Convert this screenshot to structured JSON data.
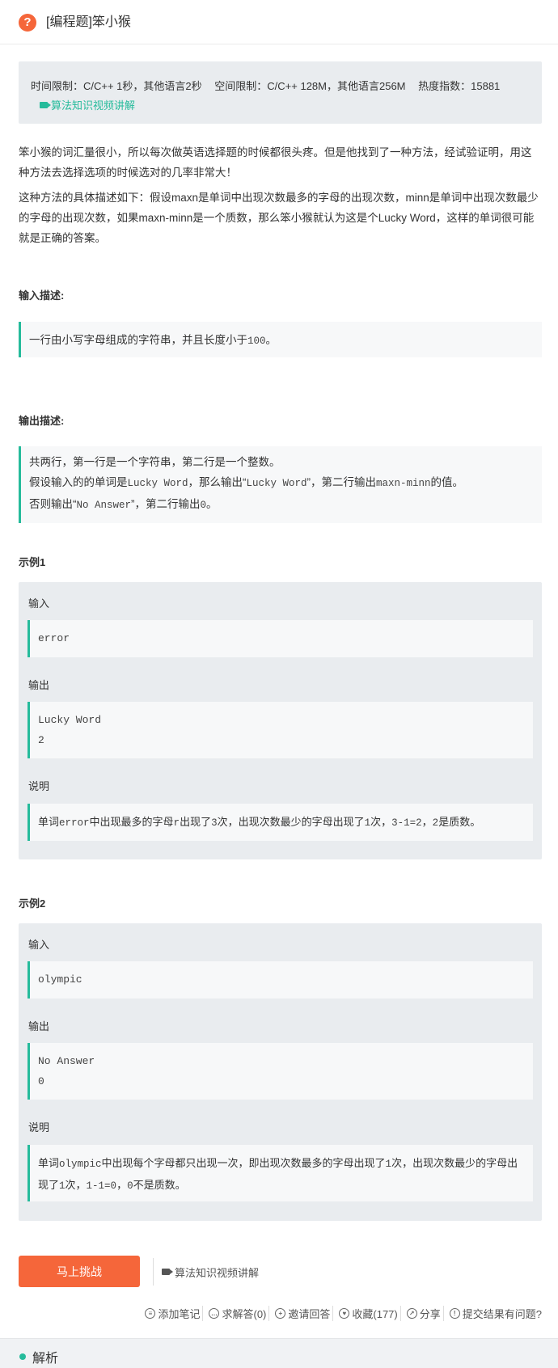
{
  "header": {
    "title": "[编程题]笨小猴",
    "icon": "question-circle-icon"
  },
  "meta": {
    "time_limit": "时间限制：C/C++ 1秒，其他语言2秒",
    "space_limit": "空间限制：C/C++ 128M，其他语言256M",
    "heat": "热度指数：15881",
    "video_link": "算法知识视频讲解"
  },
  "description": {
    "p1": "笨小猴的词汇量很小，所以每次做英语选择题的时候都很头疼。但是他找到了一种方法，经试验证明，用这种方法去选择选项的时候选对的几率非常大！",
    "p2": "这种方法的具体描述如下：假设maxn是单词中出现次数最多的字母的出现次数，minn是单词中出现次数最少的字母的出现次数，如果maxn-minn是一个质数，那么笨小猴就认为这是个Lucky Word，这样的单词很可能就是正确的答案。"
  },
  "input_desc": {
    "heading": "输入描述:",
    "pre": "一行由小写字母组成的字符串，并且长度小于",
    "num": "100",
    "post": "。"
  },
  "output_desc": {
    "heading": "输出描述:",
    "line1": "共两行，第一行是一个字符串，第二行是一个整数。",
    "line2_a": "假设输入的的单词是",
    "line2_b": "Lucky Word",
    "line2_c": "，那么输出“",
    "line2_d": "Lucky Word",
    "line2_e": "”，第二行输出",
    "line2_f": "maxn-minn",
    "line2_g": "的值。",
    "line3_a": "否则输出“",
    "line3_b": "No Answer",
    "line3_c": "”，第二行输出",
    "line3_d": "0",
    "line3_e": "。"
  },
  "example1": {
    "heading": "示例1",
    "input_label": "输入",
    "input": "error",
    "output_label": "输出",
    "output_line1": "Lucky Word",
    "output_line2": "2",
    "explain_label": "说明",
    "explain": [
      "单词",
      "error",
      "中出现最多的字母",
      "r",
      "出现了",
      "3",
      "次，出现次数最少的字母出现了",
      "1",
      "次，",
      "3-1=2",
      "，",
      "2",
      "是质数。"
    ]
  },
  "example2": {
    "heading": "示例2",
    "input_label": "输入",
    "input": "olympic",
    "output_label": "输出",
    "output_line1": "No Answer",
    "output_line2": "0",
    "explain_label": "说明",
    "explain": [
      "单词",
      "olympic",
      "中出现每个字母都只出现一次，即出现次数最多的字母出现了",
      "1",
      "次，出现次数最少的字母出现了",
      "1",
      "次，",
      "1-1=0",
      "，",
      "0",
      "不是质数。"
    ]
  },
  "actions": {
    "challenge_button": "马上挑战",
    "video_link": "算法知识视频讲解",
    "add_note": "添加笔记",
    "ask_answer": "求解答(0)",
    "invite": "邀请回答",
    "favorite": "收藏(177)",
    "share": "分享",
    "report": "提交结果有问题?"
  },
  "analysis": {
    "label": "解析"
  },
  "colors": {
    "accent": "#25bb9b",
    "brand": "#f5663a"
  }
}
